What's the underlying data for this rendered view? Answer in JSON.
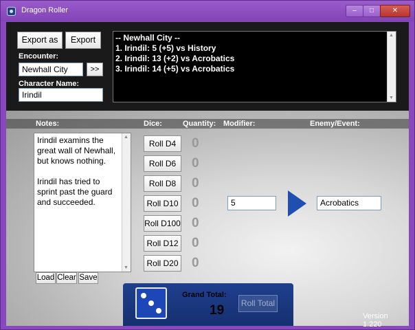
{
  "window": {
    "title": "Dragon Roller",
    "min_label": "–",
    "max_label": "□",
    "close_label": "✕"
  },
  "top": {
    "export_as_label": "Export as",
    "export_label": "Export",
    "encounter_label": "Encounter:",
    "encounter_value": "Newhall City",
    "go_label": ">>",
    "character_label": "Character Name:",
    "character_value": "Irindil",
    "results": [
      "-- Newhall City --",
      "1. Irindil: 5 (+5) vs History",
      "2. Irindil: 13 (+2) vs Acrobatics",
      "3. Irindil: 14 (+5) vs Acrobatics"
    ]
  },
  "headers": {
    "notes": "Notes:",
    "dice": "Dice:",
    "quantity": "Quantity:",
    "modifier": "Modifier:",
    "enemy": "Enemy/Event:"
  },
  "notes": {
    "text": "Irindil examins the great wall of Newhall, but knows nothing.\n\nIrindil has tried to sprint past the guard and succeeded.",
    "load_label": "Load",
    "clear_label": "Clear",
    "save_label": "Save"
  },
  "dice": [
    {
      "label": "Roll D4",
      "quantity": "0"
    },
    {
      "label": "Roll D6",
      "quantity": "0"
    },
    {
      "label": "Roll D8",
      "quantity": "0"
    },
    {
      "label": "Roll D10",
      "quantity": "0"
    },
    {
      "label": "Roll D100",
      "quantity": "0"
    },
    {
      "label": "Roll D12",
      "quantity": "0"
    },
    {
      "label": "Roll D20",
      "quantity": "0"
    }
  ],
  "modifier_value": "5",
  "enemy_value": "Acrobatics",
  "bottom": {
    "grand_total_label": "Grand Total:",
    "grand_total_value": "19",
    "roll_total_label": "Roll Total"
  },
  "version": "Version 1.220",
  "colors": {
    "accent": "#8a48bf",
    "panel_dark": "#1a1a1a",
    "arrow_blue": "#1f4fb0",
    "footer_blue": "#1f3f8f"
  },
  "icons": {
    "app": "dragon-roller-app-icon",
    "dice": "dice-icon",
    "arrow": "play-arrow-icon"
  }
}
